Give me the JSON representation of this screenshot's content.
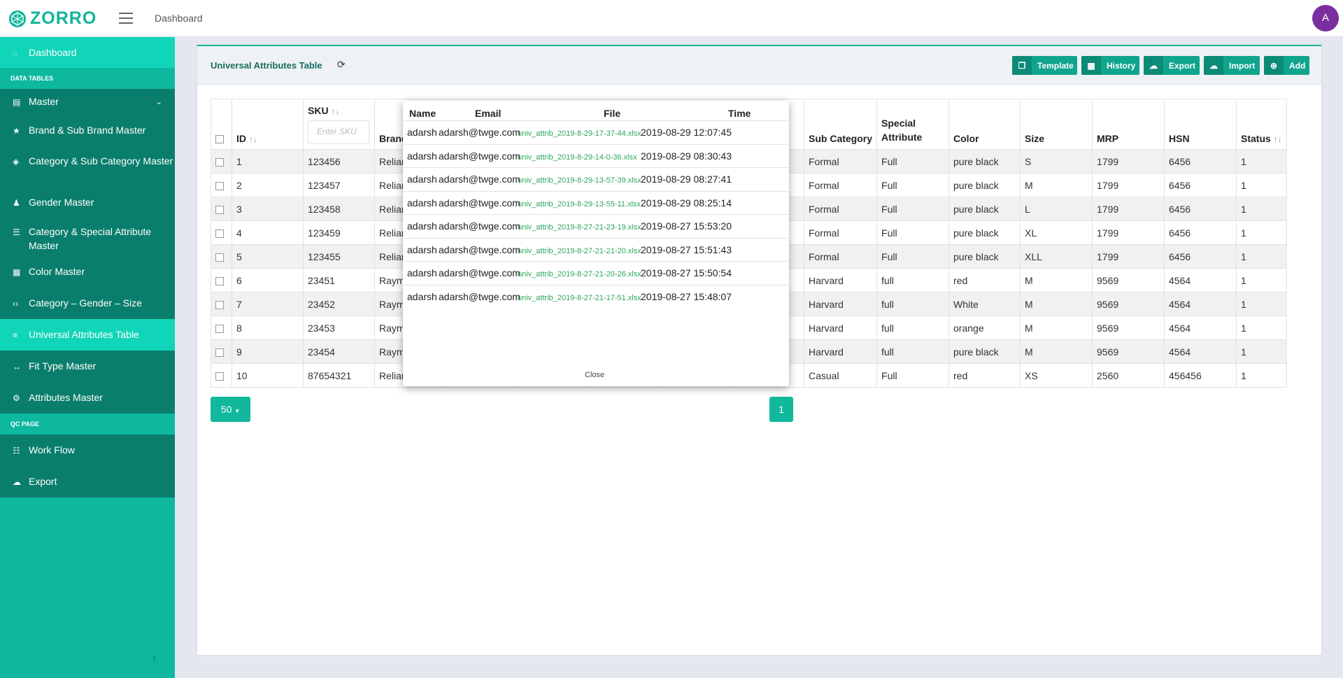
{
  "header": {
    "logo_text": "ZORRO",
    "breadcrumb": "Dashboard",
    "avatar_initial": "A"
  },
  "sidebar": {
    "dashboard": "Dashboard",
    "section_data_tables": "DATA TABLES",
    "items": [
      {
        "label": "Master",
        "icon": "database-icon"
      },
      {
        "label": "Brand & Sub Brand Master",
        "icon": "star-icon"
      },
      {
        "label": "Category & Sub Category Master",
        "icon": "layers-icon"
      },
      {
        "label": "Gender Master",
        "icon": "person-icon"
      },
      {
        "label": "Category & Special Attribute Master",
        "icon": "sliders-icon"
      },
      {
        "label": "Color Master",
        "icon": "grid-icon"
      },
      {
        "label": "Category – Gender – Size",
        "icon": "code-icon"
      },
      {
        "label": "Universal Attributes Table",
        "icon": "list-icon"
      },
      {
        "label": "Fit Type Master",
        "icon": "arrows-h-icon"
      },
      {
        "label": "Attributes Master",
        "icon": "cogs-icon"
      }
    ],
    "section_qc": "QC PAGE",
    "qc_items": [
      {
        "label": "Work Flow",
        "icon": "list-alt-icon"
      },
      {
        "label": "Export",
        "icon": "cloud-upload-icon"
      }
    ]
  },
  "card": {
    "title": "Universal Attributes Table",
    "buttons": {
      "template": "Template",
      "history": "History",
      "export": "Export",
      "import": "Import",
      "add": "Add"
    }
  },
  "table": {
    "headers": {
      "id": "ID",
      "sku": "SKU",
      "sku_placeholder": "Enter SKU",
      "brand": "Brand",
      "sub_category": "Sub Category",
      "special_attribute": "Special Attribute",
      "color": "Color",
      "size": "Size",
      "mrp": "MRP",
      "hsn": "HSN",
      "status": "Status"
    },
    "rows": [
      {
        "id": "1",
        "sku": "123456",
        "brand": "Relian",
        "sub_category": "Formal",
        "special": "Full",
        "color": "pure black",
        "size": "S",
        "mrp": "1799",
        "hsn": "6456",
        "status": "1"
      },
      {
        "id": "2",
        "sku": "123457",
        "brand": "Relian",
        "sub_category": "Formal",
        "special": "Full",
        "color": "pure black",
        "size": "M",
        "mrp": "1799",
        "hsn": "6456",
        "status": "1"
      },
      {
        "id": "3",
        "sku": "123458",
        "brand": "Relian",
        "sub_category": "Formal",
        "special": "Full",
        "color": "pure black",
        "size": "L",
        "mrp": "1799",
        "hsn": "6456",
        "status": "1"
      },
      {
        "id": "4",
        "sku": "123459",
        "brand": "Relian",
        "sub_category": "Formal",
        "special": "Full",
        "color": "pure black",
        "size": "XL",
        "mrp": "1799",
        "hsn": "6456",
        "status": "1"
      },
      {
        "id": "5",
        "sku": "123455",
        "brand": "Relian",
        "sub_category": "Formal",
        "special": "Full",
        "color": "pure black",
        "size": "XLL",
        "mrp": "1799",
        "hsn": "6456",
        "status": "1"
      },
      {
        "id": "6",
        "sku": "23451",
        "brand": "Raym",
        "sub_category": "Harvard",
        "special": "full",
        "color": "red",
        "size": "M",
        "mrp": "9569",
        "hsn": "4564",
        "status": "1"
      },
      {
        "id": "7",
        "sku": "23452",
        "brand": "Raym",
        "sub_category": "Harvard",
        "special": "full",
        "color": "White",
        "size": "M",
        "mrp": "9569",
        "hsn": "4564",
        "status": "1"
      },
      {
        "id": "8",
        "sku": "23453",
        "brand": "Raym",
        "sub_category": "Harvard",
        "special": "full",
        "color": "orange",
        "size": "M",
        "mrp": "9569",
        "hsn": "4564",
        "status": "1"
      },
      {
        "id": "9",
        "sku": "23454",
        "brand": "Raym",
        "sub_category": "Harvard",
        "special": "full",
        "color": "pure black",
        "size": "M",
        "mrp": "9569",
        "hsn": "4564",
        "status": "1"
      },
      {
        "id": "10",
        "sku": "87654321",
        "brand": "Relian",
        "sub_category": "Casual",
        "special": "Full",
        "color": "red",
        "size": "XS",
        "mrp": "2560",
        "hsn": "456456",
        "status": "1"
      }
    ]
  },
  "pagination": {
    "page_size": "50",
    "current_page": "1"
  },
  "history_modal": {
    "headers": {
      "name": "Name",
      "email": "Email",
      "file": "File",
      "time": "Time"
    },
    "rows": [
      {
        "name": "adarsh",
        "email": "adarsh@twge.com",
        "file": "univ_attrib_2019-8-29-17-37-44.xlsx",
        "time": "2019-08-29 12:07:45"
      },
      {
        "name": "adarsh",
        "email": "adarsh@twge.com",
        "file": "univ_attrib_2019-8-29-14-0-36.xlsx",
        "time": "2019-08-29 08:30:43"
      },
      {
        "name": "adarsh",
        "email": "adarsh@twge.com",
        "file": "univ_attrib_2019-8-29-13-57-39.xlsx",
        "time": "2019-08-29 08:27:41"
      },
      {
        "name": "adarsh",
        "email": "adarsh@twge.com",
        "file": "univ_attrib_2019-8-29-13-55-11.xlsx",
        "time": "2019-08-29 08:25:14"
      },
      {
        "name": "adarsh",
        "email": "adarsh@twge.com",
        "file": "univ_attrib_2019-8-27-21-23-19.xlsx",
        "time": "2019-08-27 15:53:20"
      },
      {
        "name": "adarsh",
        "email": "adarsh@twge.com",
        "file": "univ_attrib_2019-8-27-21-21-20.xlsx",
        "time": "2019-08-27 15:51:43"
      },
      {
        "name": "adarsh",
        "email": "adarsh@twge.com",
        "file": "univ_attrib_2019-8-27-21-20-26.xlsx",
        "time": "2019-08-27 15:50:54"
      },
      {
        "name": "adarsh",
        "email": "adarsh@twge.com",
        "file": "univ_attrib_2019-8-27-21-17-51.xlsx",
        "time": "2019-08-27 15:48:07"
      }
    ],
    "close_label": "Close"
  },
  "colors": {
    "brand_teal": "#0fb59a",
    "sidebar_dark": "#0a7e6c",
    "sidebar_active": "#11d5b8",
    "avatar_purple": "#7b2f9e"
  }
}
